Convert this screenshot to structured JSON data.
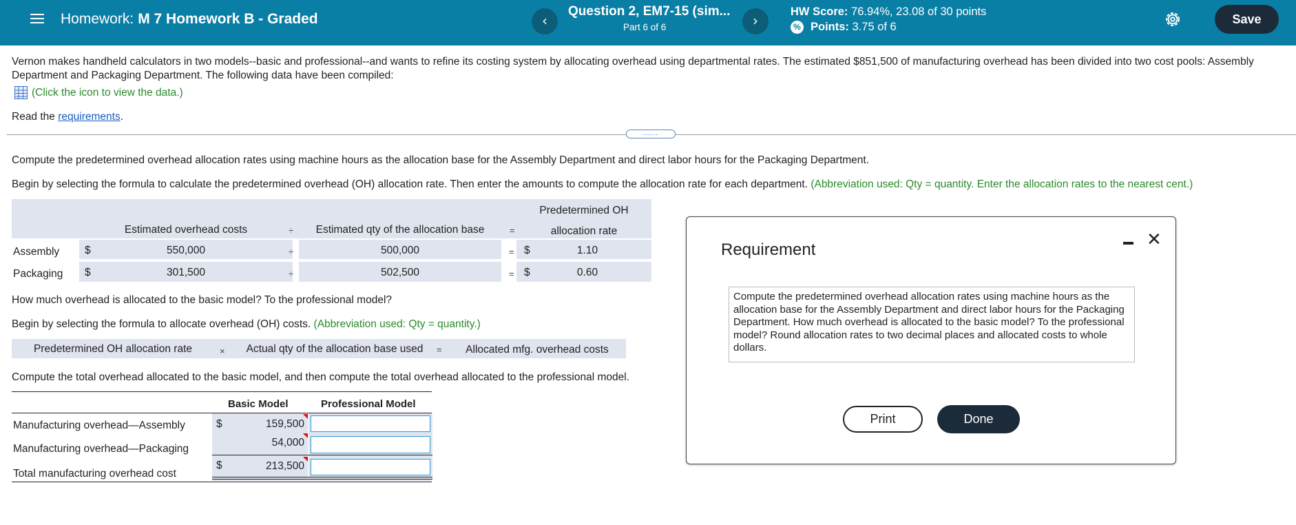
{
  "header": {
    "hw_prefix": "Homework:",
    "hw_name": "M 7 Homework B - Graded",
    "question_title": "Question 2, EM7-15 (sim...",
    "question_part": "Part 6 of 6",
    "hw_score_label": "HW Score:",
    "hw_score_value": "76.94%, 23.08 of 30 points",
    "points_label": "Points:",
    "points_value": "3.75 of 6",
    "save_label": "Save",
    "prev_glyph": "‹",
    "next_glyph": "›",
    "colors": {
      "bar": "#0a7fa6",
      "save": "#1c2b3a"
    }
  },
  "problem": {
    "intro": "Vernon makes handheld calculators in two models--basic and professional--and wants to refine its costing system by allocating overhead using departmental rates. The estimated $851,500 of manufacturing overhead has been divided into two cost pools: Assembly Department and Packaging Department. The following data have been compiled:",
    "data_link": "(Click the icon to view the data.)",
    "read_prefix": "Read the",
    "req_link": "requirements",
    "read_suffix": ".",
    "divider_handle": "......"
  },
  "part_a": {
    "instruction1": "Compute the predetermined overhead allocation rates using machine hours as the allocation base for the Assembly Department and direct labor hours for the Packaging Department.",
    "instruction2": "Begin by selecting the formula to calculate the predetermined overhead (OH) allocation rate. Then enter the amounts to compute the allocation rate for each department.",
    "instruction2_note": "(Abbreviation used: Qty = quantity. Enter the allocation rates to the nearest cent.)",
    "table": {
      "col1": "Estimated overhead costs",
      "col2": "Estimated qty of the allocation base",
      "col3_line1": "Predetermined OH",
      "col3_line2": "allocation rate",
      "div_op": "÷",
      "eq_op": "=",
      "dollar": "$",
      "rows": [
        {
          "label": "Assembly",
          "cost": "550,000",
          "qty": "500,000",
          "rate": "1.10"
        },
        {
          "label": "Packaging",
          "cost": "301,500",
          "qty": "502,500",
          "rate": "0.60"
        }
      ]
    }
  },
  "part_b": {
    "question": "How much overhead is allocated to the basic model? To the professional model?",
    "instruction": "Begin by selecting the formula to allocate overhead (OH) costs.",
    "instruction_note": "(Abbreviation used: Qty = quantity.)",
    "formula": {
      "term1": "Predetermined OH allocation rate",
      "op1": "×",
      "term2": "Actual qty of the allocation base used",
      "op2": "=",
      "result": "Allocated mfg. overhead costs"
    },
    "instruction2": "Compute the total overhead allocated to the basic model, and then compute the total overhead allocated to the professional model.",
    "table": {
      "col_basic": "Basic Model",
      "col_prof": "Professional Model",
      "dollar": "$",
      "rows": [
        {
          "label": "Manufacturing overhead—Assembly",
          "basic": "159,500",
          "prof": ""
        },
        {
          "label": "Manufacturing overhead—Packaging",
          "basic": "54,000",
          "prof": ""
        },
        {
          "label": "Total manufacturing overhead cost",
          "basic": "213,500",
          "prof": ""
        }
      ]
    }
  },
  "dialog": {
    "title": "Requirement",
    "text": "Compute the predetermined overhead allocation rates using machine hours as the allocation base for the Assembly Department and direct labor hours for the Packaging Department. How much overhead is allocated to the basic model? To the professional model? Round allocation rates to two decimal places and allocated costs to whole dollars.",
    "print_label": "Print",
    "done_label": "Done",
    "close_glyph": "✕"
  }
}
